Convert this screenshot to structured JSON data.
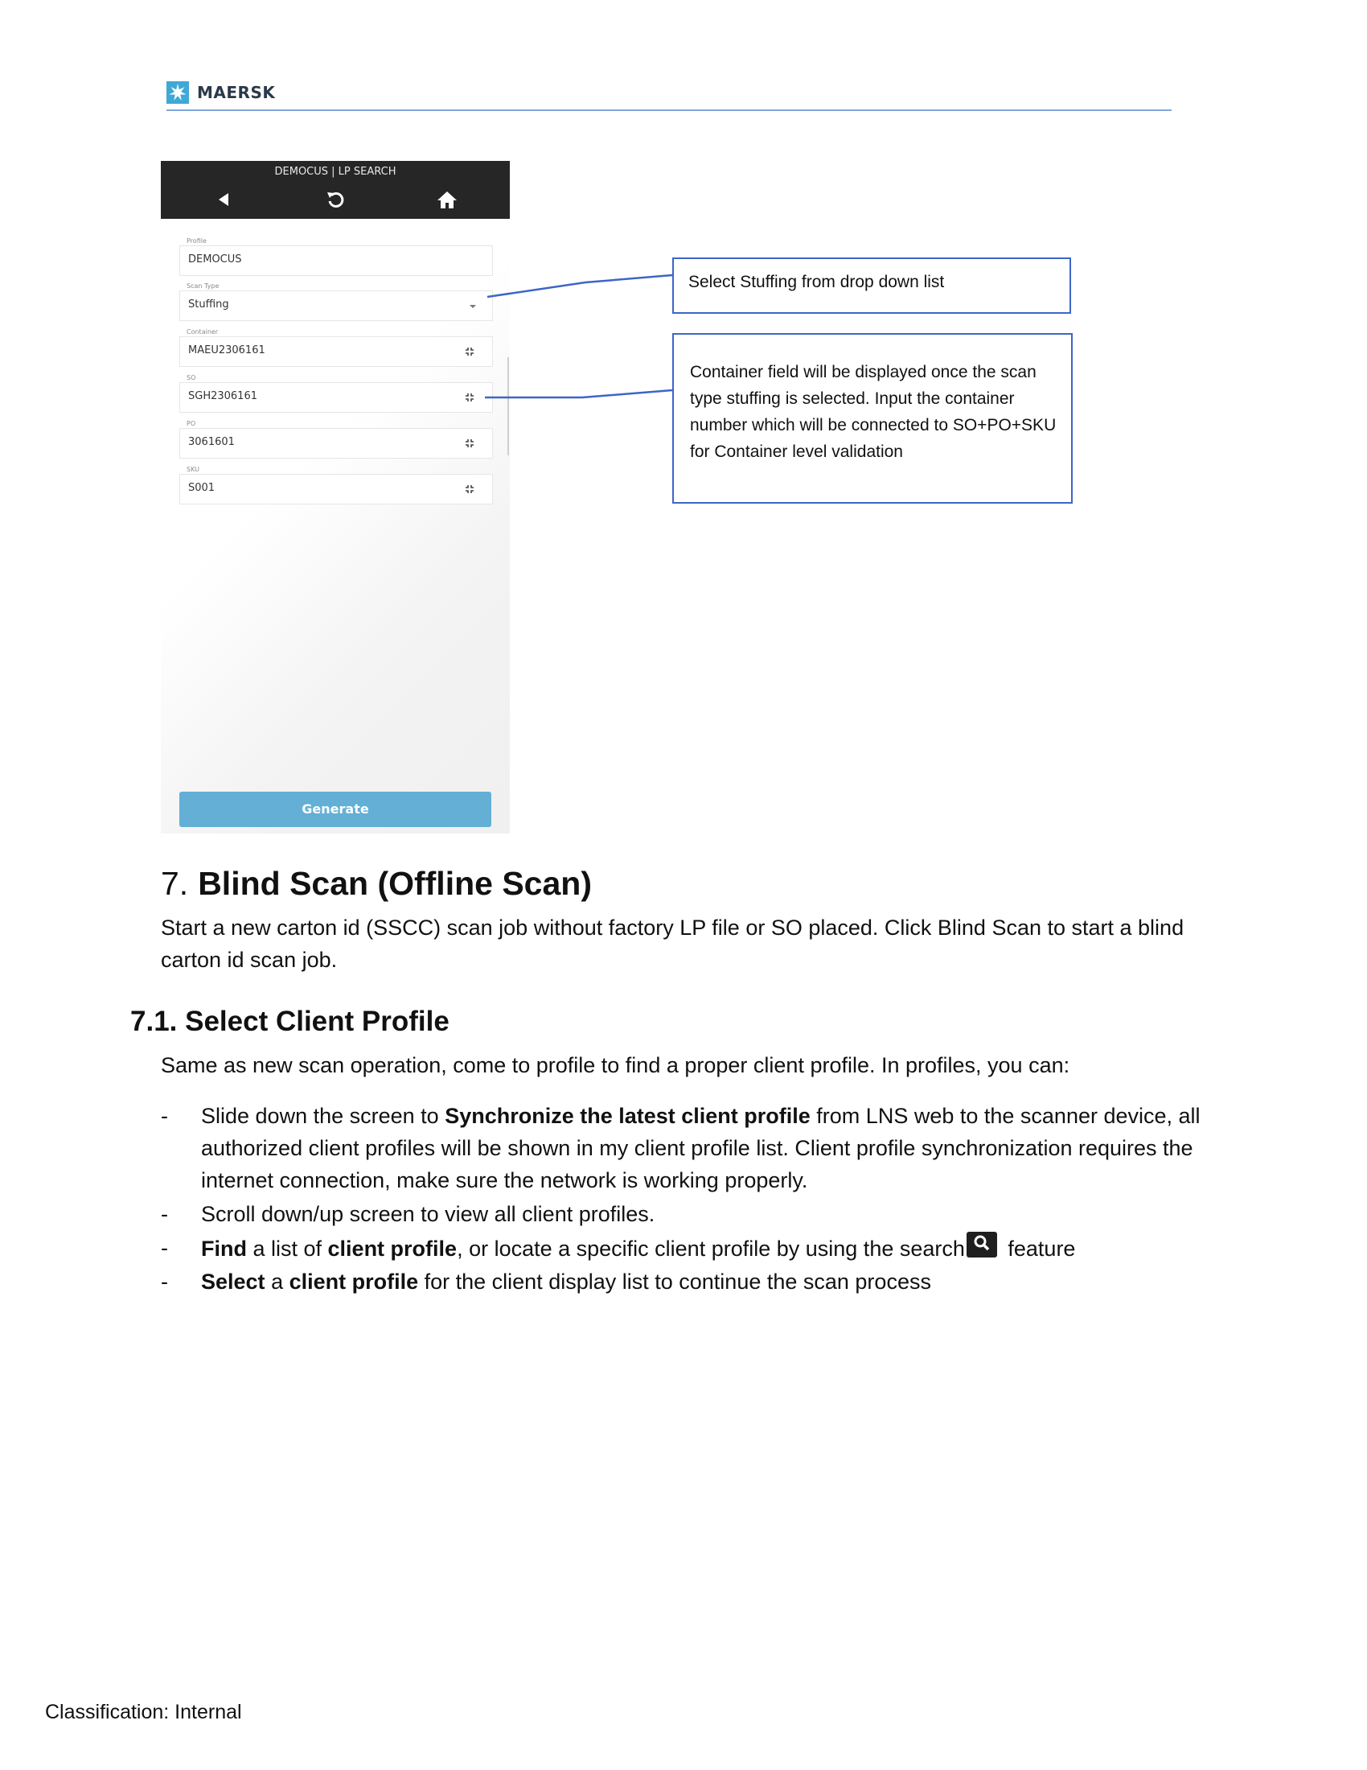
{
  "header": {
    "brand": "MAERSK",
    "accent": "#3fa9d6"
  },
  "phone": {
    "title": "DEMOCUS | LP SEARCH",
    "fields": [
      {
        "label": "Profile",
        "value": "DEMOCUS"
      },
      {
        "label": "Scan Type",
        "value": "Stuffing"
      },
      {
        "label": "Container",
        "value": "MAEU2306161"
      },
      {
        "label": "SO",
        "value": "SGH2306161"
      },
      {
        "label": "PO",
        "value": "3061601"
      },
      {
        "label": "SKU",
        "value": "S001"
      }
    ],
    "generate_label": "Generate",
    "generate_color": "#63afd6"
  },
  "callouts": {
    "stuffing": "Select Stuffing from drop down list",
    "container": "Container field will be displayed once the scan type stuffing is selected. Input the container number which will be connected to SO+PO+SKU for Container level validation",
    "border_color": "#3d66c7"
  },
  "section7": {
    "number": "7.",
    "title": "Blind Scan (Offline Scan)",
    "intro": "Start a new carton id (SSCC) scan job without factory LP file or SO placed. Click Blind Scan to start a blind carton id scan job."
  },
  "section71": {
    "title": "7.1.  Select Client Profile",
    "intro": "Same as new scan operation, come to profile to find a proper client profile. In profiles, you can:",
    "bullets": [
      {
        "before": "Slide down the screen to ",
        "bold": "Synchronize the latest client profile",
        "after": " from LNS web to the scanner device, all authorized client profiles will be shown in my client profile list. Client profile synchronization requires the internet connection, make sure the network is working properly."
      },
      {
        "text": "Scroll down/up screen to view all client profiles."
      },
      {
        "bold1": "Find",
        "mid1": " a list of ",
        "bold2": "client profile",
        "mid2": ", or locate a specific client profile by using the search",
        "after": " feature"
      },
      {
        "bold1": "Select",
        "mid1": " a ",
        "bold2": "client profile",
        "after": " for the client display list to continue the scan process"
      }
    ],
    "dash": "-"
  },
  "footer": {
    "classification": "Classification: Internal"
  }
}
